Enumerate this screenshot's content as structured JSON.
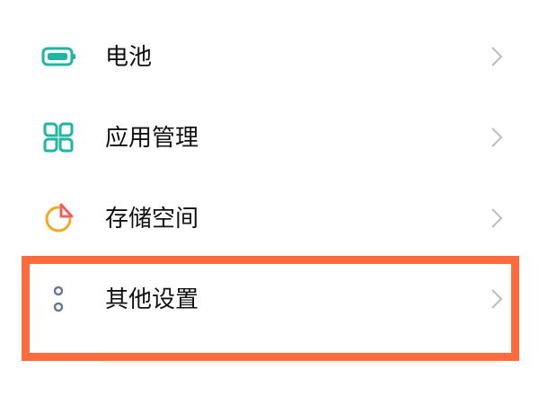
{
  "settings": {
    "items": [
      {
        "label": "电池",
        "icon": "battery-icon",
        "icon_color": "#1FB5A0"
      },
      {
        "label": "应用管理",
        "icon": "apps-grid-icon",
        "icon_color": "#1FB5A0"
      },
      {
        "label": "存储空间",
        "icon": "storage-pie-icon",
        "icon_color": "#F2A922",
        "accent_color": "#F0605A"
      },
      {
        "label": "其他设置",
        "icon": "more-dots-icon",
        "icon_color": "#6B7A99"
      }
    ],
    "chevron_icon": "chevron-right-icon",
    "chevron_color": "#BDBDBD",
    "highlight_color": "#FF6B3D",
    "highlighted_index": 3
  }
}
